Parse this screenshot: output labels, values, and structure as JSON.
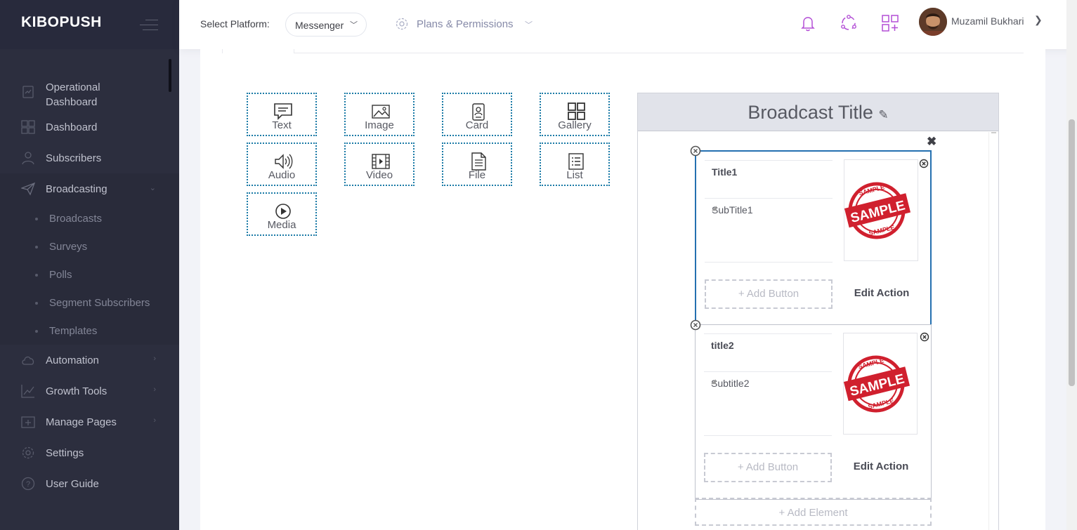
{
  "brand": {
    "name": "KIBOPUSH"
  },
  "sidebar": {
    "items": [
      {
        "label": "Operational Dashboard",
        "icon": "clipboard-icon"
      },
      {
        "label": "Dashboard",
        "icon": "grid-icon"
      },
      {
        "label": "Subscribers",
        "icon": "user-icon"
      },
      {
        "label": "Broadcasting",
        "icon": "paper-plane-icon"
      },
      {
        "label": "Automation",
        "icon": "cloud-icon"
      },
      {
        "label": "Growth Tools",
        "icon": "line-chart-icon"
      },
      {
        "label": "Manage Pages",
        "icon": "page-plus-icon"
      },
      {
        "label": "Settings",
        "icon": "gear-icon"
      },
      {
        "label": "User Guide",
        "icon": "question-icon"
      }
    ],
    "broadcasting_sub": [
      "Broadcasts",
      "Surveys",
      "Polls",
      "Segment Subscribers",
      "Templates"
    ]
  },
  "header": {
    "select_platform_label": "Select Platform:",
    "platform_value": "Messenger",
    "plans_label": "Plans & Permissions",
    "user_name": "Muzamil Bukhari"
  },
  "components": [
    {
      "label": "Text",
      "icon": "message-icon"
    },
    {
      "label": "Image",
      "icon": "image-icon"
    },
    {
      "label": "Card",
      "icon": "id-card-icon"
    },
    {
      "label": "Gallery",
      "icon": "gallery-icon"
    },
    {
      "label": "Audio",
      "icon": "speaker-icon"
    },
    {
      "label": "Video",
      "icon": "film-icon"
    },
    {
      "label": "File",
      "icon": "file-icon"
    },
    {
      "label": "List",
      "icon": "list-icon"
    },
    {
      "label": "Media",
      "icon": "play-circle-icon"
    }
  ],
  "preview": {
    "title": "Broadcast Title",
    "cards": [
      {
        "title": "Title1",
        "subtitle": "SubTitle1",
        "add_button": "+ Add Button",
        "edit_action": "Edit Action",
        "image_text": "SAMPLE"
      },
      {
        "title": "title2",
        "subtitle": "Subtitle2",
        "add_button": "+ Add Button",
        "edit_action": "Edit Action",
        "image_text": "SAMPLE"
      }
    ],
    "add_element": "+ Add Element"
  },
  "colors": {
    "sidebar_bg": "#2c2e3e",
    "accent_blue": "#1a7aa6",
    "header_icon_pink": "#b34fd6",
    "stamp_red": "#d0202e"
  }
}
